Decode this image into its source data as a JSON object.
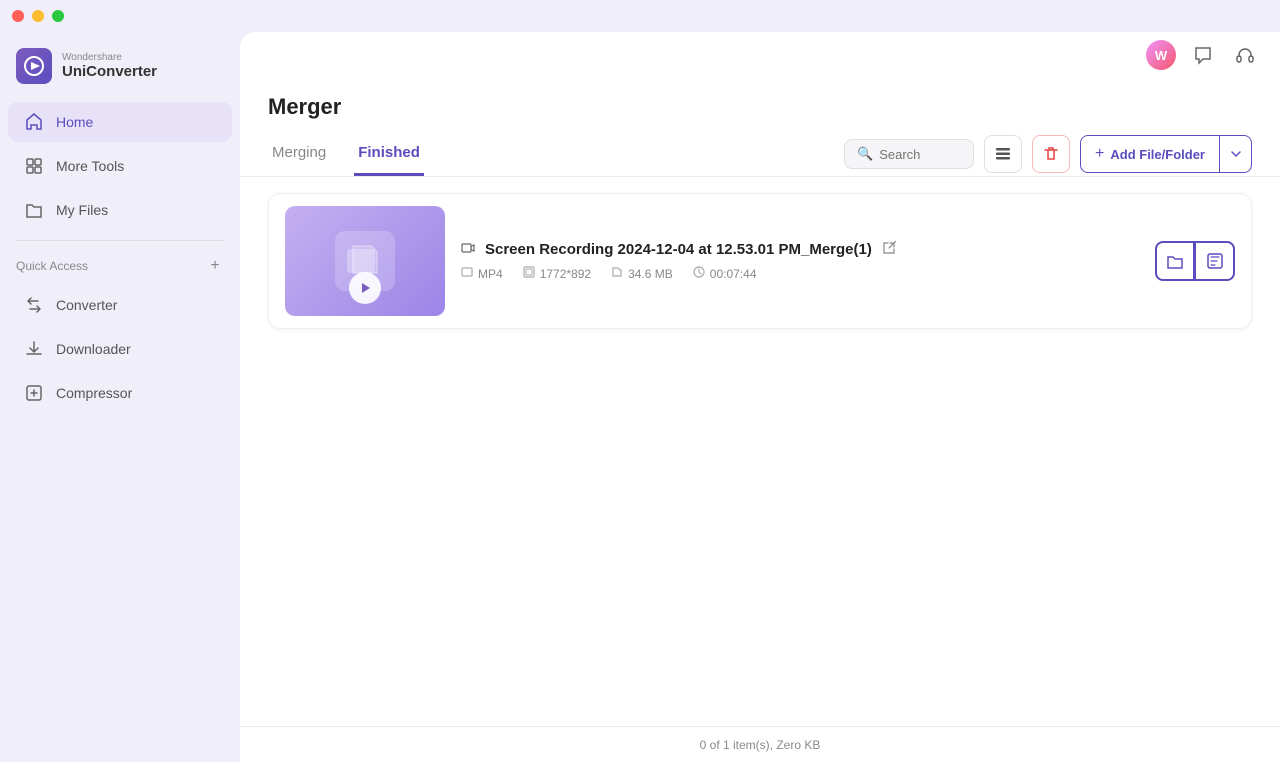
{
  "app": {
    "name": "UniConverter",
    "brand": "Wondershare",
    "logo_char": "U"
  },
  "titlebar": {
    "dots": [
      "close",
      "minimize",
      "maximize"
    ]
  },
  "sidebar": {
    "home_label": "Home",
    "more_tools_label": "More Tools",
    "my_files_label": "My Files",
    "quick_access_label": "Quick Access",
    "items": [
      {
        "id": "converter",
        "label": "Converter"
      },
      {
        "id": "downloader",
        "label": "Downloader"
      },
      {
        "id": "compressor",
        "label": "Compressor"
      }
    ]
  },
  "header": {
    "avatar_initials": "W",
    "chat_icon": "💬",
    "headphone_icon": "🎧"
  },
  "page": {
    "title": "Merger",
    "tabs": [
      {
        "id": "merging",
        "label": "Merging",
        "active": false
      },
      {
        "id": "finished",
        "label": "Finished",
        "active": true
      }
    ],
    "search_placeholder": "Search",
    "add_button_label": "Add File/Folder"
  },
  "files": [
    {
      "name": "Screen Recording 2024-12-04 at 12.53.01 PM_Merge(1)",
      "format": "MP4",
      "resolution": "1772*892",
      "size": "34.6 MB",
      "duration": "00:07:44"
    }
  ],
  "status_bar": {
    "text": "0 of 1 item(s), Zero KB"
  }
}
